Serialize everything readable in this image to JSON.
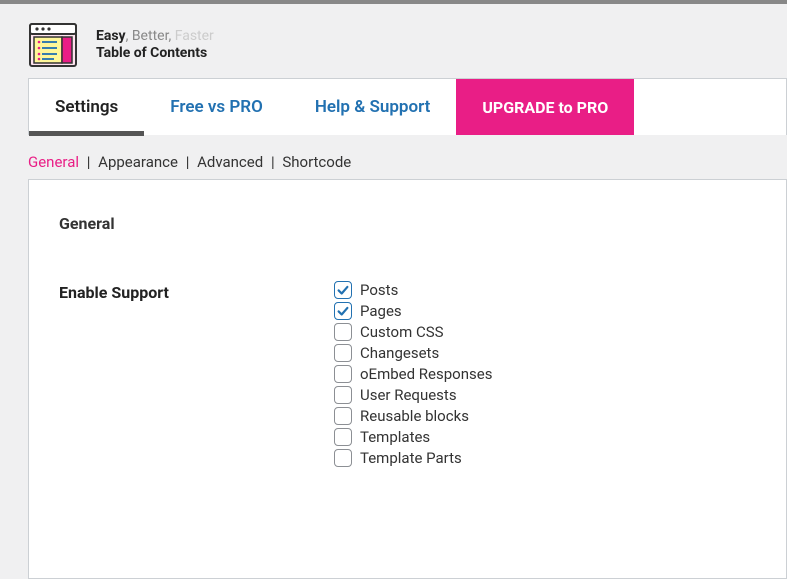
{
  "header": {
    "tagline_easy": "Easy",
    "tagline_better": ", Better, ",
    "tagline_faster": "Faster",
    "product_name": "Table of Contents"
  },
  "tabs": {
    "settings": "Settings",
    "free_vs_pro": "Free vs PRO",
    "help_support": "Help & Support",
    "upgrade": "UPGRADE to PRO"
  },
  "subtabs": {
    "general": "General",
    "appearance": "Appearance",
    "advanced": "Advanced",
    "shortcode": "Shortcode"
  },
  "section": {
    "title": "General",
    "enable_support_label": "Enable Support"
  },
  "post_types": [
    {
      "label": "Posts",
      "checked": true
    },
    {
      "label": "Pages",
      "checked": true
    },
    {
      "label": "Custom CSS",
      "checked": false
    },
    {
      "label": "Changesets",
      "checked": false
    },
    {
      "label": "oEmbed Responses",
      "checked": false
    },
    {
      "label": "User Requests",
      "checked": false
    },
    {
      "label": "Reusable blocks",
      "checked": false
    },
    {
      "label": "Templates",
      "checked": false
    },
    {
      "label": "Template Parts",
      "checked": false
    }
  ]
}
